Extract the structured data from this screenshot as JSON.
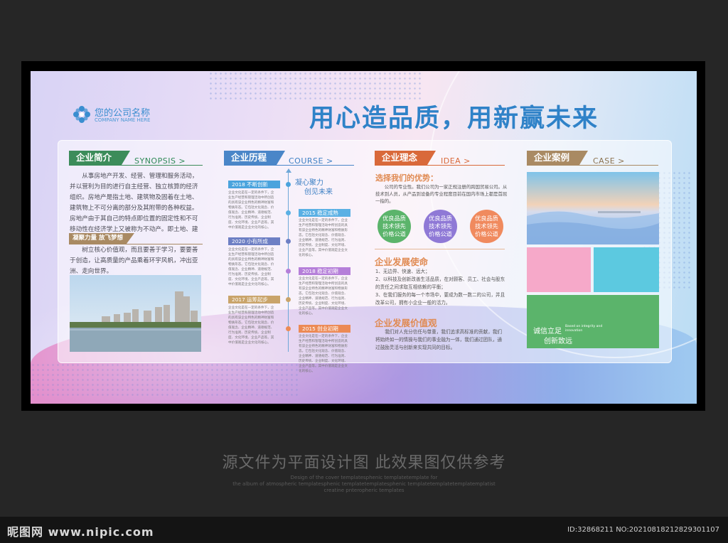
{
  "header": {
    "company_name": "您的公司名称",
    "company_name_en": "COMPANY NAME HERE",
    "slogan": "用心造品质，用新赢未来"
  },
  "sections": {
    "synopsis": {
      "title": "企业简介",
      "en": "SYNOPSIS >",
      "body": "从事房地产开发、经营、管理和服务活动，并以营利为目的进行自主经营、独立核算的经济组织。房地产是指土地、建筑物及固着在土地、建筑物上不可分离的部分及其附带的各种权益。房地产由于其自己的特点即位置的固定性和不可移动性在经济学上又被称为不动产。即土地、建筑物、房地合一。",
      "sub_title": "凝聚力量 放飞梦想",
      "sub_body": "树立核心价值观，而且要善于学习，要要善于创造，让高质量的产品乘着环宇风帆，冲出亚洲、走向世界。"
    },
    "course": {
      "title": "企业历程",
      "en": "COURSE >",
      "motto_line1": "凝心聚力",
      "motto_line2": "创见未来",
      "items": [
        {
          "label": "2018 不断创新",
          "color": "#4aa3dd"
        },
        {
          "label": "2015 稳定成熟",
          "color": "#5ab0e4"
        },
        {
          "label": "2020 小有所成",
          "color": "#6d7fc4"
        },
        {
          "label": "2018 稳定初期",
          "color": "#b57fd9"
        },
        {
          "label": "2017 运筹起步",
          "color": "#c9a46a"
        },
        {
          "label": "2015 创业初期",
          "color": "#ec8a55"
        }
      ],
      "item_text": "企业文化是在一定的条件下，企业生产经营和管理活动中所创造的具有该企业特色的精神财富和物质形态。它包括文化观念、价值观念、企业精神、道德规范、行为准则、历史传统、企业制度、文化环境、企业产品等。其中价值观是企业文化的核心。"
    },
    "idea": {
      "title": "企业理念",
      "en": "IDEA >",
      "advantage_title": "选择我们的优势：",
      "advantage_body": "公司的专业性。我们公司为一家正规注册的跨国贸易公司。从技术到人员，从产品到设备的专业程度目前在国内市场上都是首屈一指的。",
      "circles": [
        {
          "text": "优良品质\n技术领先\n价格公道",
          "color": "#5bb46b"
        },
        {
          "text": "优良品质\n技术领先\n价格公道",
          "color": "#8f79d6"
        },
        {
          "text": "优良品质\n技术领先\n价格公道",
          "color": "#f08a5e"
        }
      ],
      "mission_title": "企业发展使命",
      "mission_items": [
        "1、无边界、快速、远大；",
        "2、以科技及创新改善生活品质，在对顾客、员工、社会与股东的责任之间求取互相依赖的平衡；",
        "3、在我们服务的每一个市场中，要成为数一数二的公司，并且改革公司，拥有小企业一般的活力。"
      ],
      "value_title": "企业发展价值观",
      "value_body": "我们对人充分信任与尊重，我们追求高标准的贡献，我们将始终如一的情操与我们的事业融为一体，我们通过团队，通过鼓励灵活与创新来实现共同的目标。"
    },
    "case": {
      "title": "企业案例",
      "en": "CASE >",
      "tile_colors": [
        "#f6a9c9",
        "#5cc9e0",
        "#5bb46b"
      ],
      "green_main": "诚信立足",
      "green_sub": "创新致远",
      "green_en": "Based on integrity and innovation"
    }
  },
  "footer": {
    "main": "源文件为平面设计图 此效果图仅供参考",
    "sub": "Design of the cover templatesphenic templatetemplate for\nthe album of atmospheric templatesphenic templatetemplatesphenic templatetemplatetemplatemplatist\ncreatine pnteropheric templates"
  },
  "watermark": {
    "site": "昵图网 www.nipic.com",
    "id": "ID:32868211 NO:20210818212829301107"
  }
}
